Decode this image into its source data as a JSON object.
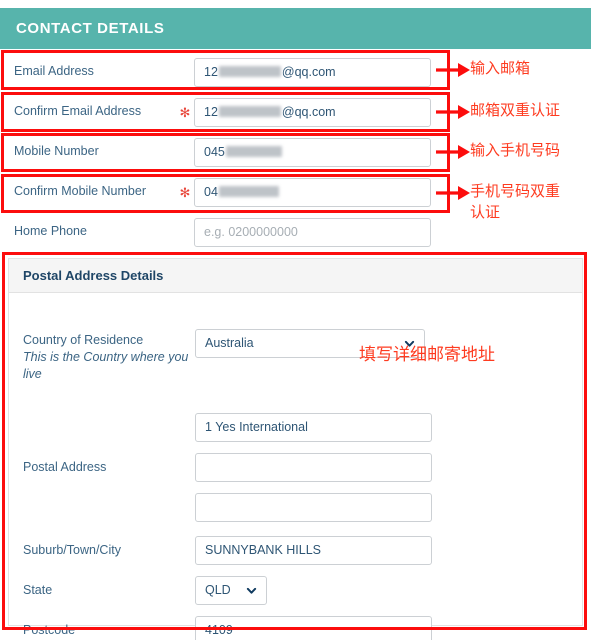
{
  "section": {
    "title": "CONTACT DETAILS",
    "accent_color": "#57b4ac"
  },
  "fields": {
    "email": {
      "label": "Email Address",
      "value_prefix": "12",
      "value_suffix": "@qq.com",
      "required_marker": "",
      "redacted": true
    },
    "confirm_email": {
      "label": "Confirm Email Address",
      "value_prefix": "12",
      "value_suffix": "@qq.com",
      "required_marker": "✻",
      "redacted": true
    },
    "mobile": {
      "label": "Mobile Number",
      "value_prefix": "045",
      "value_suffix": "",
      "required_marker": "",
      "redacted": true
    },
    "confirm_mobile": {
      "label": "Confirm Mobile Number",
      "value_prefix": "04",
      "value_suffix": "",
      "required_marker": "✻",
      "redacted": true
    },
    "home_phone": {
      "label": "Home Phone",
      "value": "",
      "placeholder": "e.g. 0200000000",
      "required_marker": ""
    }
  },
  "postal": {
    "panel_title": "Postal Address Details",
    "country": {
      "label": "Country of Residence",
      "sub_label": "This is the Country where you live",
      "value": "Australia"
    },
    "address": {
      "label": "Postal Address",
      "line1": "1 Yes International",
      "line2": "",
      "line3": ""
    },
    "suburb": {
      "label": "Suburb/Town/City",
      "value": "SUNNYBANK HILLS"
    },
    "state": {
      "label": "State",
      "value": "QLD"
    },
    "postcode": {
      "label": "Postcode",
      "value": "4109"
    }
  },
  "annotations": {
    "color": "#fe3b20",
    "box_color": "#fc0d0d",
    "note_email": "输入邮箱",
    "note_confirm_email": "邮箱双重认证",
    "note_mobile": "输入手机号码",
    "note_confirm_mobile": "手机号码双重\n认证",
    "note_postal": "填写详细邮寄地址"
  }
}
